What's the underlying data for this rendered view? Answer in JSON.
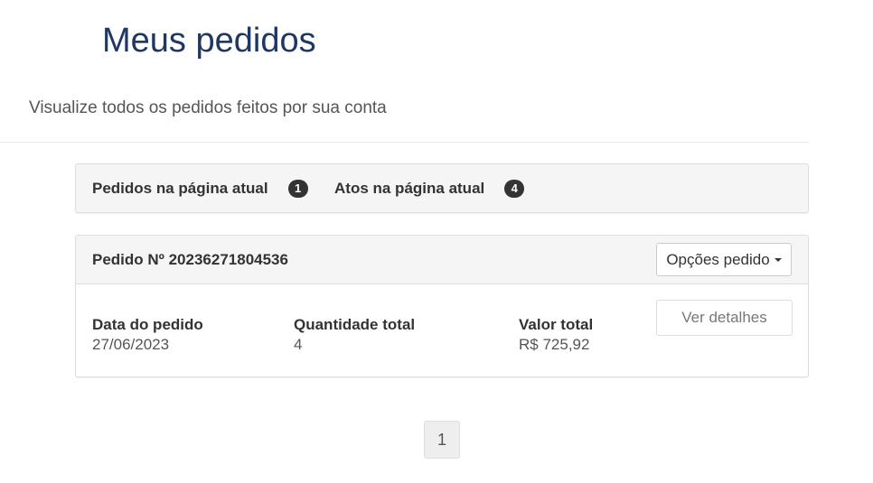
{
  "page": {
    "title": "Meus pedidos",
    "subtitle": "Visualize todos os pedidos feitos por sua conta"
  },
  "summary": {
    "orders_label": "Pedidos na página atual",
    "orders_count": "1",
    "acts_label": "Atos na página atual",
    "acts_count": "4"
  },
  "order": {
    "number": "Pedido Nº 20236271804536",
    "options_label": "Opções pedido",
    "date_label": "Data do pedido",
    "date_value": "27/06/2023",
    "quantity_label": "Quantidade total",
    "quantity_value": "4",
    "total_label": "Valor total",
    "total_value": "R$ 725,92",
    "details_label": "Ver detalhes"
  },
  "pagination": {
    "current_page": "1"
  },
  "icons": {
    "options_caret": "caret-down-icon"
  },
  "colors": {
    "title": "#1f3763",
    "badge_bg": "#333333",
    "panel_bg": "#f5f5f5",
    "border": "#dddddd"
  }
}
